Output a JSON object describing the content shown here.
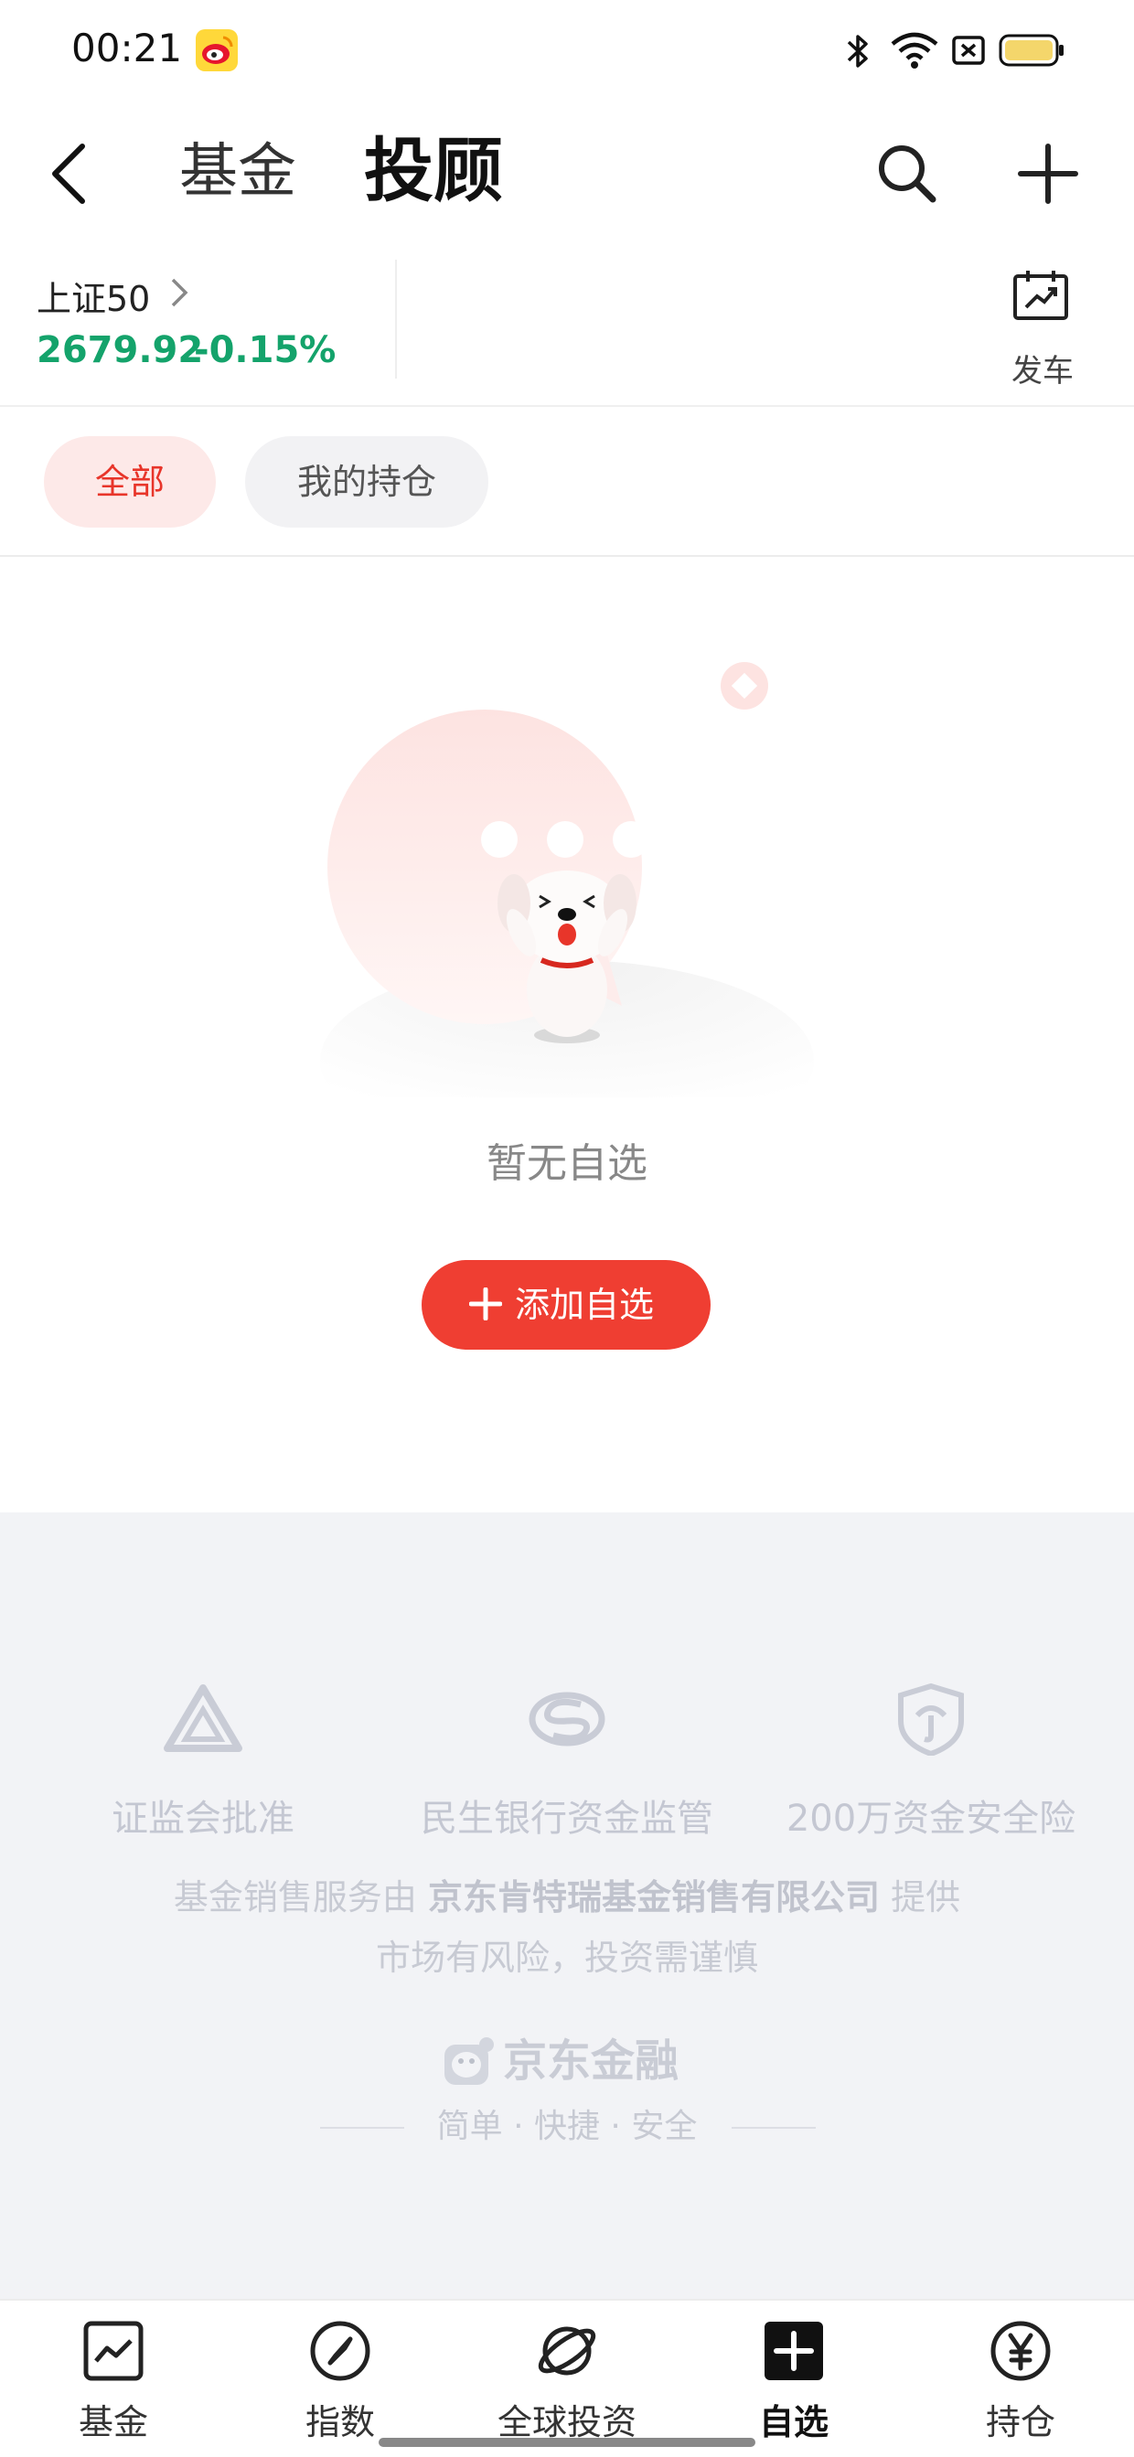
{
  "status_bar": {
    "time": "00:21",
    "icons": [
      "weibo-icon",
      "bluetooth-icon",
      "wifi-icon",
      "sim-off-icon",
      "battery-icon"
    ]
  },
  "header": {
    "tabs": [
      {
        "label": "基金",
        "active": false
      },
      {
        "label": "投顾",
        "active": true
      }
    ],
    "icons": [
      "back-icon",
      "search-icon",
      "plus-icon"
    ]
  },
  "index_bar": {
    "name": "上证50",
    "value": "2679.92",
    "change": "-0.15%",
    "change_color": "#14a36b",
    "launch_label": "发车"
  },
  "filters": [
    {
      "label": "全部",
      "active": true
    },
    {
      "label": "我的持仓",
      "active": false
    }
  ],
  "empty_state": {
    "message": "暂无自选",
    "button_label": "添加自选",
    "accent_color": "#ef3e32"
  },
  "trust": {
    "items": [
      {
        "label": "证监会批准",
        "icon": "regulator-icon"
      },
      {
        "label": "民生银行资金监管",
        "icon": "bank-icon"
      },
      {
        "label": "200万资金安全险",
        "icon": "shield-icon"
      }
    ],
    "service_prefix": "基金销售服务由",
    "service_company": "京东肯特瑞基金销售有限公司",
    "service_suffix": "提供",
    "risk_notice": "市场有风险，投资需谨慎",
    "brand_name": "京东金融",
    "slogan": "简单 · 快捷 · 安全"
  },
  "bottom_nav": [
    {
      "label": "基金",
      "icon": "chart-icon",
      "active": false
    },
    {
      "label": "指数",
      "icon": "compass-icon",
      "active": false
    },
    {
      "label": "全球投资",
      "icon": "planet-icon",
      "active": false
    },
    {
      "label": "自选",
      "icon": "plus-square-icon",
      "active": true
    },
    {
      "label": "持仓",
      "icon": "yen-icon",
      "active": false
    }
  ]
}
